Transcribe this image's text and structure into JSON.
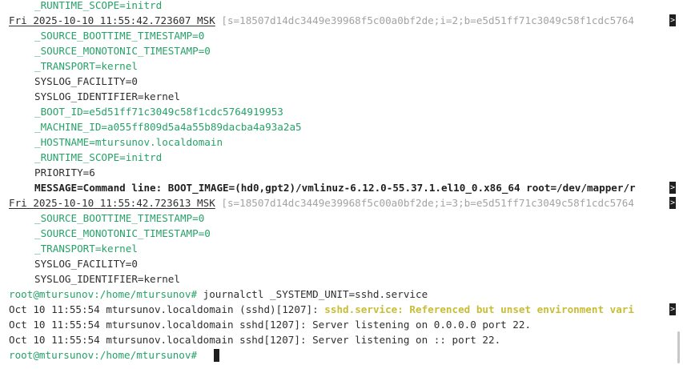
{
  "terminal": {
    "lines": {
      "l0": {
        "text": "_RUNTIME_SCOPE=initrd"
      },
      "l1": {
        "time": "Fri 2025-10-10 11:55:42.723607 MSK",
        "cursor": " [s=18507d14dc3449e39968f5c00a0bf2de;i=2;b=e5d51ff71c3049c58f1cdc5764"
      },
      "l2": {
        "text": "_SOURCE_BOOTTIME_TIMESTAMP=0"
      },
      "l3": {
        "text": "_SOURCE_MONOTONIC_TIMESTAMP=0"
      },
      "l4": {
        "text": "_TRANSPORT=kernel"
      },
      "l5": {
        "text": "SYSLOG_FACILITY=0"
      },
      "l6": {
        "text": "SYSLOG_IDENTIFIER=kernel"
      },
      "l7": {
        "text": "_BOOT_ID=e5d51ff71c3049c58f1cdc5764919953"
      },
      "l8": {
        "text": "_MACHINE_ID=a055ff809d5a4a55b89dacba4a93a2a5"
      },
      "l9": {
        "text": "_HOSTNAME=mtursunov.localdomain"
      },
      "l10": {
        "text": "_RUNTIME_SCOPE=initrd"
      },
      "l11": {
        "text": "PRIORITY=6"
      },
      "l12": {
        "text": "MESSAGE=Command line: BOOT_IMAGE=(hd0,gpt2)/vmlinuz-6.12.0-55.37.1.el10_0.x86_64 root=/dev/mapper/r"
      },
      "l13": {
        "time": "Fri 2025-10-10 11:55:42.723613 MSK",
        "cursor": " [s=18507d14dc3449e39968f5c00a0bf2de;i=3;b=e5d51ff71c3049c58f1cdc5764"
      },
      "l14": {
        "text": "_SOURCE_BOOTTIME_TIMESTAMP=0"
      },
      "l15": {
        "text": "_SOURCE_MONOTONIC_TIMESTAMP=0"
      },
      "l16": {
        "text": "_TRANSPORT=kernel"
      },
      "l17": {
        "text": "SYSLOG_FACILITY=0"
      },
      "l18": {
        "text": "SYSLOG_IDENTIFIER=kernel"
      },
      "l19": {
        "prompt": "root@mtursunov:/home/mtursunov#",
        "command": " journalctl _SYSTEMD_UNIT=sshd.service"
      },
      "l20": {
        "prefix": "Oct 10 11:55:54 mtursunov.localdomain (sshd)[1207]: ",
        "message": "sshd.service: Referenced but unset environment vari"
      },
      "l21": {
        "text": "Oct 10 11:55:54 mtursunov.localdomain sshd[1207]: Server listening on 0.0.0.0 port 22."
      },
      "l22": {
        "text": "Oct 10 11:55:54 mtursunov.localdomain sshd[1207]: Server listening on :: port 22."
      },
      "l23": {
        "prompt": "root@mtursunov:/home/mtursunov#",
        "command": " "
      }
    },
    "truncation_marker": ">"
  }
}
